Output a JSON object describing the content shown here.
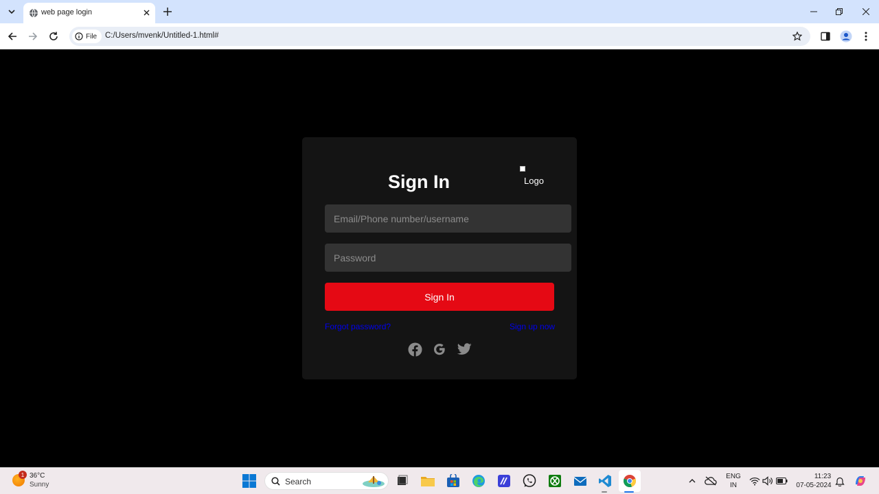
{
  "browser": {
    "tab_title": "web page login",
    "address_chip": "File",
    "url": "C:/Users/mvenk/Untitled-1.html#"
  },
  "page": {
    "heading": "Sign In",
    "logo_alt": "Logo",
    "email_placeholder": "Email/Phone number/username",
    "password_placeholder": "Password",
    "submit_label": "Sign In",
    "forgot_link": "Forgot password?",
    "signup_link": "Sign up now",
    "social_icons": [
      "facebook-icon",
      "google-icon",
      "twitter-icon"
    ]
  },
  "colors": {
    "accent": "#e50914",
    "card_bg": "#141414",
    "field_bg": "#333333",
    "link": "#0000ee"
  },
  "taskbar": {
    "weather_badge": "1",
    "weather_temp": "36°C",
    "weather_condition": "Sunny",
    "search_label": "Search",
    "language_line1": "ENG",
    "language_line2": "IN",
    "time": "11:23",
    "date": "07-05-2024"
  }
}
